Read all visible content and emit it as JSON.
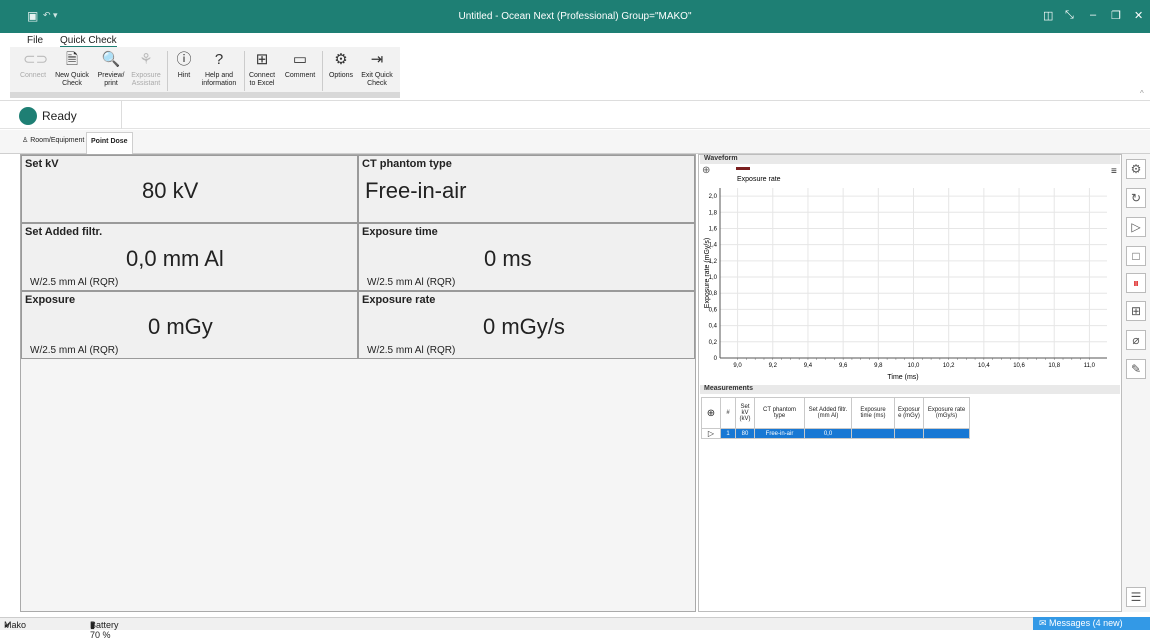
{
  "window": {
    "title": "Untitled - Ocean Next (Professional)   Group=\"MAKO\""
  },
  "menu": {
    "file": "File",
    "quick_check": "Quick Check"
  },
  "ribbon": {
    "connect": "Connect",
    "new_quick_check": "New Quick Check",
    "preview_print": "Preview/ print",
    "exposure_assistant": "Exposure Assistant",
    "hint": "Hint",
    "help": "Help and information",
    "connect_excel": "Connect to Excel",
    "comment": "Comment",
    "options": "Options",
    "exit_quick_check": "Exit Quick Check"
  },
  "status": {
    "text": "Ready",
    "color": "#1e7f74"
  },
  "tabs": {
    "room": "Room/Equipment",
    "point_dose": "Point Dose"
  },
  "cells": {
    "set_kv": {
      "label": "Set kV",
      "value": "80 kV"
    },
    "ct_phantom": {
      "label": "CT phantom type",
      "value": "Free-in-air"
    },
    "added_filtr": {
      "label": "Set Added filtr.",
      "value": "0,0 mm Al",
      "sub": "W/2.5 mm Al (RQR)"
    },
    "exposure_time": {
      "label": "Exposure time",
      "value": "0 ms",
      "sub": "W/2.5 mm Al (RQR)"
    },
    "exposure": {
      "label": "Exposure",
      "value": "0 mGy",
      "sub": "W/2.5 mm Al (RQR)"
    },
    "exposure_rate": {
      "label": "Exposure rate",
      "value": "0 mGy/s",
      "sub": "W/2.5 mm Al (RQR)"
    }
  },
  "waveform": {
    "heading": "Waveform",
    "legend": "Exposure rate",
    "legend_color": "#7a1f1f"
  },
  "chart_data": {
    "type": "line",
    "title": "",
    "xlabel": "Time (ms)",
    "ylabel": "Exposure rate (mGy/s)",
    "xlim": [
      8.9,
      11.1
    ],
    "ylim": [
      0,
      2.1
    ],
    "xticks": [
      "9,0",
      "9,2",
      "9,4",
      "9,6",
      "9,8",
      "10,0",
      "10,2",
      "10,4",
      "10,6",
      "10,8",
      "11,0"
    ],
    "yticks": [
      "0",
      "0,2",
      "0,4",
      "0,6",
      "0,8",
      "1,0",
      "1,2",
      "1,4",
      "1,6",
      "1,8",
      "2,0"
    ],
    "series": [
      {
        "name": "Exposure rate",
        "x": [],
        "y": []
      }
    ],
    "grid": true,
    "legend": "top-left"
  },
  "measurements": {
    "heading": "Measurements",
    "headers": [
      "#",
      "Set kV (kV)",
      "CT phantom type",
      "Set Added filtr. (mm Al)",
      "Exposure time (ms)",
      "Exposur e (mGy)",
      "Exposure rate (mGy/s)"
    ],
    "rows": [
      [
        "1",
        "80",
        "Free-in-air",
        "0,0",
        "",
        "",
        ""
      ]
    ]
  },
  "footer": {
    "user": "Mako",
    "battery": "Battery 70 %",
    "messages": "Messages (4 new)"
  }
}
